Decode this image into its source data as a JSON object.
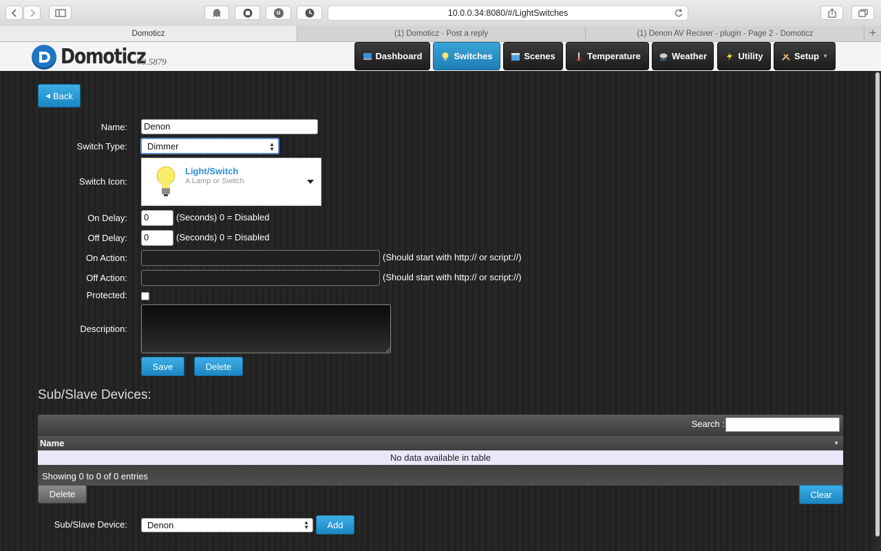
{
  "browser": {
    "url": "10.0.0.34:8080/#/LightSwitches",
    "tabs": [
      "Domoticz",
      "(1) Domoticz - Post a reply",
      "(1) Denon AV Reciver - plugin - Page 2 - Domoticz"
    ],
    "new_tab": "+",
    "extension_letter": "u"
  },
  "header": {
    "logo": "Domoticz",
    "version": "V3.5879",
    "nav": [
      "Dashboard",
      "Switches",
      "Scenes",
      "Temperature",
      "Weather",
      "Utility",
      "Setup"
    ],
    "active_nav": "Switches"
  },
  "form": {
    "back_label": "Back",
    "name_label": "Name:",
    "name_value": "Denon",
    "switch_type_label": "Switch Type:",
    "switch_type_value": "Dimmer",
    "switch_icon_label": "Switch Icon:",
    "icon_title": "Light/Switch",
    "icon_subtitle": "A Lamp or Switch",
    "on_delay_label": "On Delay:",
    "on_delay_value": "0",
    "off_delay_label": "Off Delay:",
    "off_delay_value": "0",
    "delay_hint": "(Seconds) 0 = Disabled",
    "on_action_label": "On Action:",
    "on_action_value": "",
    "off_action_label": "Off Action:",
    "off_action_value": "",
    "action_hint": "(Should start with http:// or script://)",
    "protected_label": "Protected:",
    "protected_checked": false,
    "description_label": "Description:",
    "description_value": "",
    "save_label": "Save",
    "delete_label": "Delete"
  },
  "subdevices": {
    "title": "Sub/Slave Devices:",
    "search_label": "Search :",
    "search_value": "",
    "column_name": "Name",
    "empty_text": "No data available in table",
    "info_text": "Showing 0 to 0 of 0 entries",
    "delete_label": "Delete",
    "clear_label": "Clear",
    "device_label": "Sub/Slave Device:",
    "device_value": "Denon",
    "add_label": "Add"
  }
}
